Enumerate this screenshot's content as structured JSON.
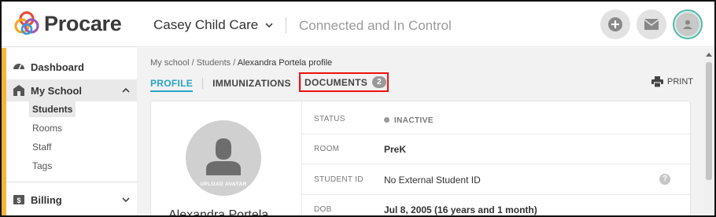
{
  "header": {
    "brand": "Procare",
    "school_name": "Casey Child Care",
    "tagline": "Connected and In Control"
  },
  "sidebar": {
    "items": [
      {
        "label": "Dashboard",
        "icon": "dashboard-icon"
      },
      {
        "label": "My School",
        "icon": "school-icon"
      },
      {
        "label": "Billing",
        "icon": "billing-icon"
      }
    ],
    "my_school_sub": [
      {
        "label": "Students",
        "active": true
      },
      {
        "label": "Rooms"
      },
      {
        "label": "Staff"
      },
      {
        "label": "Tags"
      }
    ]
  },
  "breadcrumb": {
    "root": "My school",
    "section": "Students",
    "current": "Alexandra Portela profile",
    "separator": "/"
  },
  "tabs": {
    "profile": "PROFILE",
    "immunizations": "IMMUNIZATIONS",
    "documents": "DOCUMENTS",
    "documents_count": "2"
  },
  "actions": {
    "print": "PRINT"
  },
  "profile": {
    "upload_avatar": "UPLOAD AVATAR",
    "name": "Alexandra Portela",
    "fields": [
      {
        "key": "STATUS",
        "value": "INACTIVE"
      },
      {
        "key": "ROOM",
        "value": "PreK"
      },
      {
        "key": "STUDENT ID",
        "value": "No External Student ID"
      },
      {
        "key": "DOB",
        "value": "Jul 8, 2005 (16 years and 1 month)"
      }
    ]
  },
  "colors": {
    "accent": "#2aa3c6",
    "sidebar_accent": "#f5b53a",
    "highlight_box": "#ee1111",
    "status_inactive": "#999999"
  }
}
